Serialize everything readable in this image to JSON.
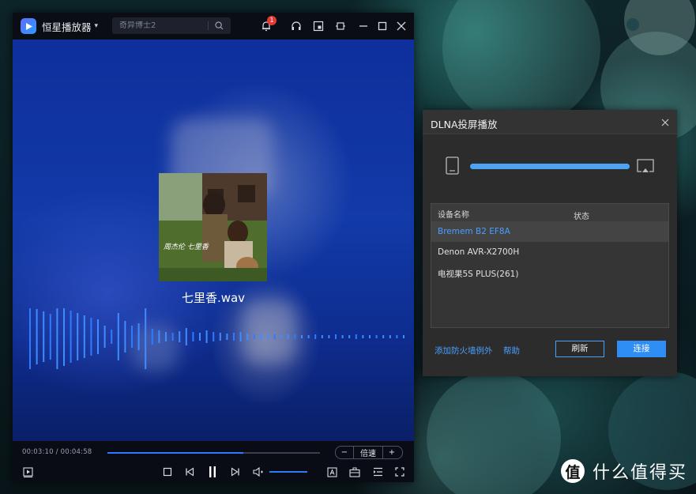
{
  "player": {
    "app_name": "恒星播放器",
    "search_placeholder": "奇异博士2",
    "notification_count": "1",
    "track_title": "七里香.wav",
    "album_art_caption": "周杰伦 七里香",
    "time_display": "00:03:10 / 00:04:58",
    "progress_fraction": 0.64,
    "speed_label": "倍速",
    "speed_decrease": "−",
    "speed_increase": "+",
    "volume_fraction": 1.0,
    "accent_color": "#2b7bff"
  },
  "dlna": {
    "title": "DLNA投屏播放",
    "col_device_name": "设备名称",
    "col_status": "状态",
    "devices": [
      {
        "name": "Bremem B2 EF8A",
        "status": "",
        "selected": true
      },
      {
        "name": "Denon AVR-X2700H",
        "status": "",
        "selected": false
      },
      {
        "name": "电视果5S PLUS(261)",
        "status": "",
        "selected": false
      }
    ],
    "add_firewall_exception": "添加防火墙例外",
    "help": "帮助",
    "refresh": "刷新",
    "connect": "连接",
    "accent_color": "#2f8ef4"
  },
  "watermark": {
    "logo_char": "值",
    "text": "什么值得买"
  }
}
